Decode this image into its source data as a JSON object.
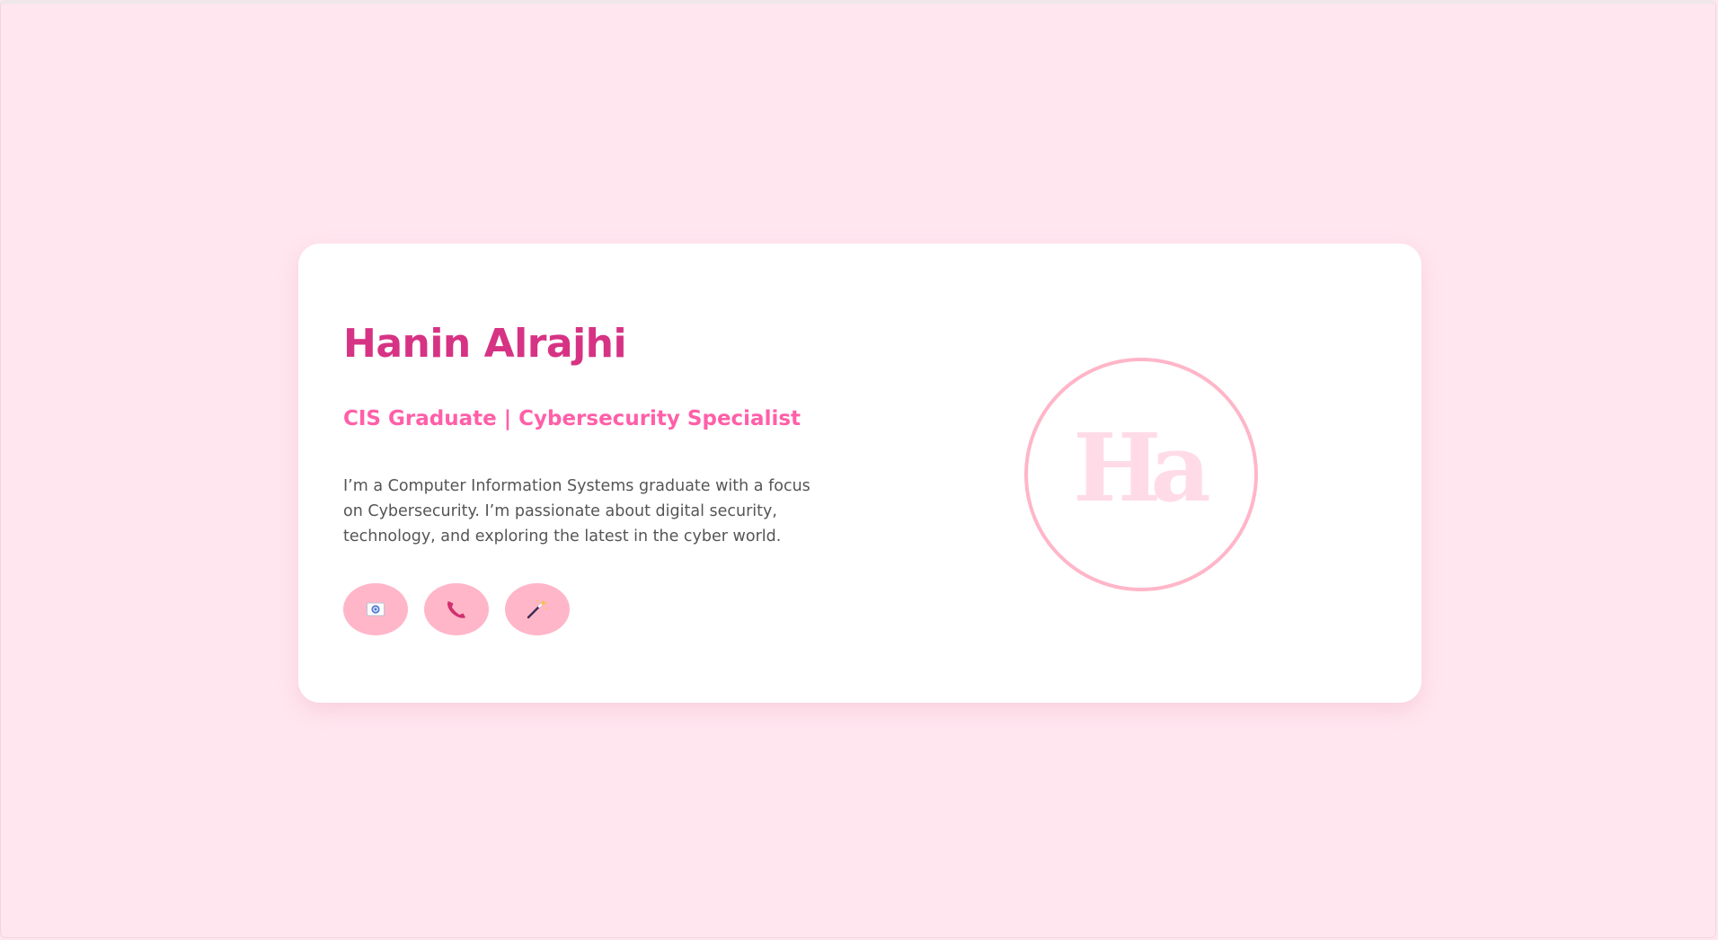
{
  "profile": {
    "name": "Hanin Alrajhi",
    "subtitle": "CIS Graduate | Cybersecurity Specialist",
    "bio": "I’m a Computer Information Systems graduate with a focus on Cybersecurity. I’m passionate about digital security, technology, and exploring the latest in the cyber world."
  },
  "logo": {
    "monogram": "Ha"
  },
  "contacts": [
    {
      "icon": "email-icon"
    },
    {
      "icon": "phone-icon"
    },
    {
      "icon": "magic-wand-icon"
    }
  ],
  "colors": {
    "background": "#ffe6ef",
    "card": "#ffffff",
    "name": "#d63384",
    "subtitle": "#ff5fa8",
    "body_text": "#555555",
    "button": "#ffb6c8",
    "logo_ring": "#ffb6c8",
    "logo_text": "#ffdbe8"
  }
}
